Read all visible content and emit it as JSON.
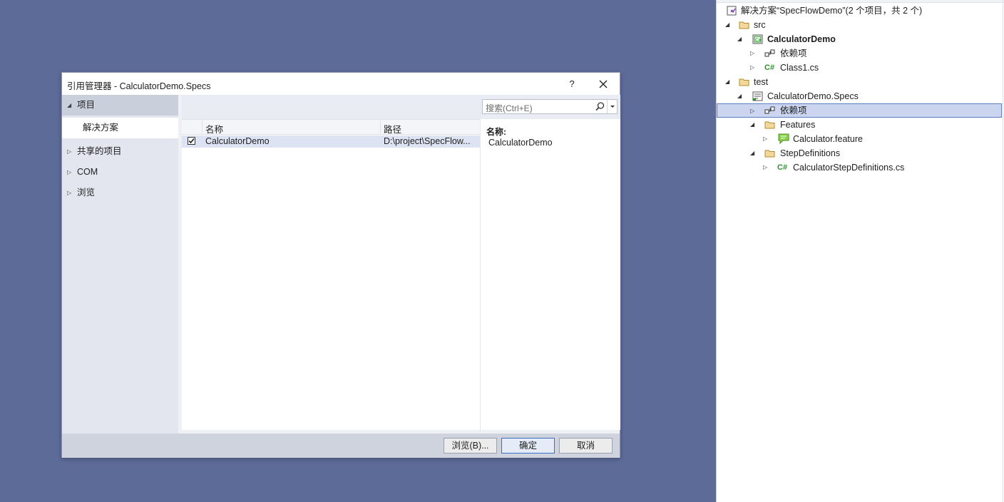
{
  "colors": {
    "background": "#5d6b99",
    "selection": "#ccd5f0",
    "accent": "#3c6ec2"
  },
  "dialog": {
    "title": "引用管理器 - CalculatorDemo.Specs",
    "help": "?",
    "nav": {
      "projects": "项目",
      "solution": "解决方案",
      "shared": "共享的项目",
      "com": "COM",
      "browse": "浏览"
    },
    "grid": {
      "col_name": "名称",
      "col_path": "路径",
      "rows": [
        {
          "checked": true,
          "name": "CalculatorDemo",
          "path": "D:\\project\\SpecFlow..."
        }
      ]
    },
    "search": {
      "placeholder": "搜索(Ctrl+E)"
    },
    "detail": {
      "label": "名称:",
      "value": "CalculatorDemo"
    },
    "buttons": {
      "browse": "浏览(B)...",
      "ok": "确定",
      "cancel": "取消"
    }
  },
  "explorer": {
    "solution": "解决方案“SpecFlowDemo”(2 个项目，共 2 个)",
    "src": "src",
    "calc_demo": "CalculatorDemo",
    "deps1": "依赖项",
    "class1": "Class1.cs",
    "test": "test",
    "specs": "CalculatorDemo.Specs",
    "deps2": "依赖项",
    "features": "Features",
    "feature_file": "Calculator.feature",
    "step_defs": "StepDefinitions",
    "step_file": "CalculatorStepDefinitions.cs"
  }
}
